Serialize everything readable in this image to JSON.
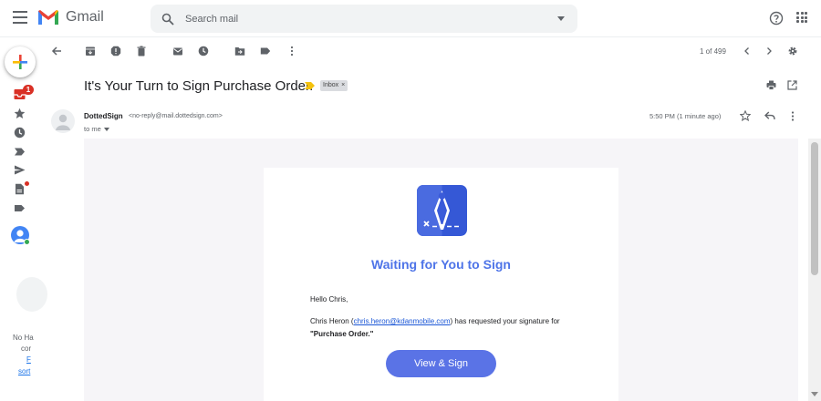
{
  "header": {
    "app_name": "Gmail",
    "search_placeholder": "Search mail"
  },
  "rail": {
    "inbox_count": "1",
    "hangouts_text_1": "No Ha",
    "hangouts_text_2": "cor",
    "hangouts_link_1": "F",
    "hangouts_link_2": "sort"
  },
  "toolbar": {
    "pager": "1 of 499"
  },
  "message": {
    "subject": "It's Your Turn to Sign Purchase Order.",
    "label": "Inbox",
    "label_remove": "×",
    "sender_name": "DottedSign",
    "sender_email": "<no-reply@mail.dottedsign.com>",
    "to": "to me",
    "time": "5:50 PM (1 minute ago)"
  },
  "email_body": {
    "title": "Waiting for You to Sign",
    "greeting": "Hello Chris,",
    "requester_name": "Chris Heron",
    "paren_open": " (",
    "requester_email": "chris.heron@kdanmobile.com",
    "text_1": ") has requested your signature for ",
    "document": "\"Purchase Order.\"",
    "button_label": "View & Sign"
  },
  "colors": {
    "brand_blue": "#4e74e8",
    "button_blue": "#5a73e6",
    "badge_red": "#d93025"
  },
  "icons": {
    "menu": "hamburger-icon",
    "search": "search-icon",
    "help": "help-icon",
    "apps": "apps-grid-icon"
  }
}
